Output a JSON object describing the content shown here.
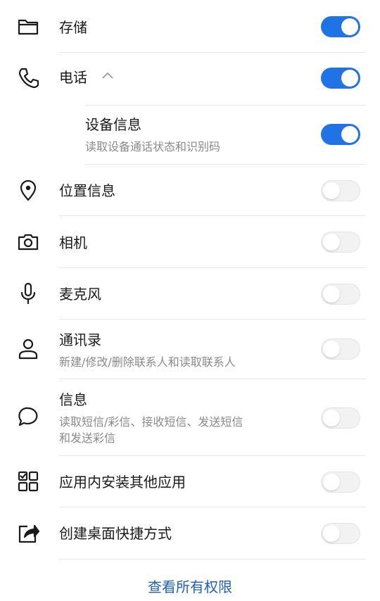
{
  "accent_color": "#1f73e5",
  "permissions": [
    {
      "id": "storage",
      "label": "存储",
      "icon": "folder-icon",
      "enabled": true
    },
    {
      "id": "phone",
      "label": "电话",
      "icon": "phone-icon",
      "enabled": true,
      "expanded": true,
      "children": [
        {
          "id": "device-info",
          "label": "设备信息",
          "desc": "读取设备通话状态和识别码",
          "enabled": true
        }
      ]
    },
    {
      "id": "location",
      "label": "位置信息",
      "icon": "location-pin-icon",
      "enabled": false
    },
    {
      "id": "camera",
      "label": "相机",
      "icon": "camera-icon",
      "enabled": false
    },
    {
      "id": "microphone",
      "label": "麦克风",
      "icon": "microphone-icon",
      "enabled": false
    },
    {
      "id": "contacts",
      "label": "通讯录",
      "icon": "person-icon",
      "desc": "新建/修改/删除联系人和读取联系人",
      "enabled": false
    },
    {
      "id": "messages",
      "label": "信息",
      "icon": "chat-bubble-icon",
      "desc_line1": "读取短信/彩信、接收短信、发送短信",
      "desc_line2": "和发送彩信",
      "enabled": false
    },
    {
      "id": "install-apps",
      "label": "应用内安装其他应用",
      "icon": "apps-grid-icon",
      "enabled": false
    },
    {
      "id": "shortcut",
      "label": "创建桌面快捷方式",
      "icon": "share-box-icon",
      "enabled": false
    }
  ],
  "footer": {
    "link_label": "查看所有权限"
  }
}
